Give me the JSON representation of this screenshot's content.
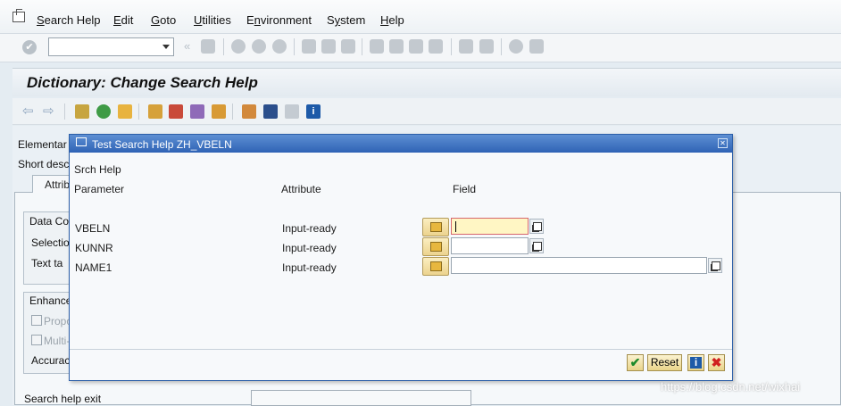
{
  "menu": {
    "items": [
      {
        "label": "Search Help",
        "underline": "S"
      },
      {
        "label": "Edit",
        "underline": "E"
      },
      {
        "label": "Goto",
        "underline": "G"
      },
      {
        "label": "Utilities",
        "underline": "U"
      },
      {
        "label": "Environment",
        "underline": "n"
      },
      {
        "label": "System",
        "underline": "y"
      },
      {
        "label": "Help",
        "underline": "H"
      }
    ]
  },
  "command_field": {
    "value": ""
  },
  "page": {
    "title": "Dictionary: Change Search Help"
  },
  "background": {
    "elementary_label": "Elementar",
    "short_desc_label": "Short desc",
    "tab_label": "Attrib",
    "data_group_label": "Data Co",
    "selection_label": "Selectio",
    "text_table_label": "Text ta",
    "enhance_group_label": "Enhance",
    "proposal_label": "Propo",
    "multi_label": "Multi-",
    "accuracy_label": "Accurac",
    "exit_label": "Search help exit"
  },
  "dialog": {
    "title": "Test Search Help ZH_VBELN",
    "srch_help_label": "Srch Help",
    "columns": {
      "parameter": "Parameter",
      "attribute": "Attribute",
      "field": "Field"
    },
    "rows": [
      {
        "parameter": "VBELN",
        "attribute": "Input-ready",
        "value": ""
      },
      {
        "parameter": "KUNNR",
        "attribute": "Input-ready",
        "value": ""
      },
      {
        "parameter": "NAME1",
        "attribute": "Input-ready",
        "value": ""
      }
    ],
    "buttons": {
      "ok": "✔",
      "reset": "Reset",
      "info": "i",
      "cancel": "✖"
    }
  },
  "watermark": "https://blog.csdn.net/wixhai"
}
